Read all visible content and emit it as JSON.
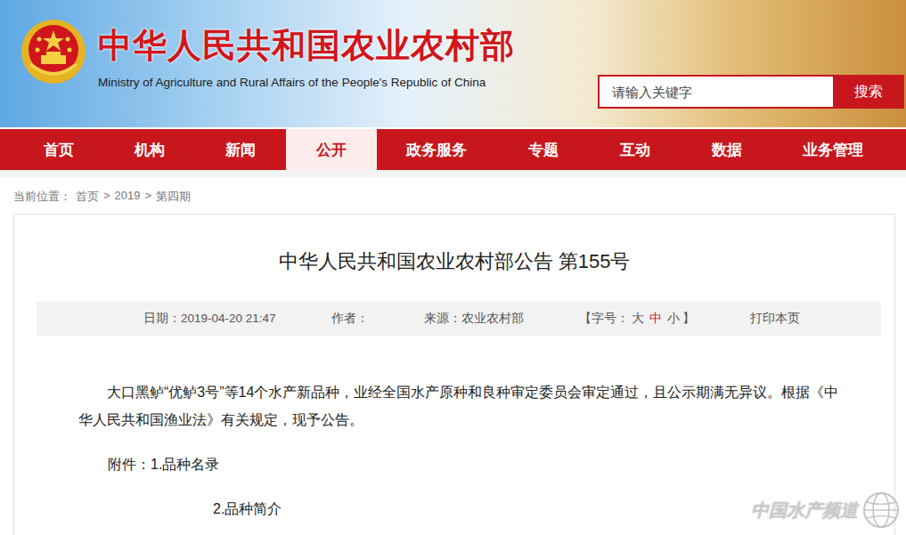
{
  "header": {
    "title": "中华人民共和国农业农村部",
    "subtitle": "Ministry of Agriculture and Rural Affairs of the People's Republic of China"
  },
  "search": {
    "placeholder": "请输入关键字",
    "button": "搜索"
  },
  "nav": [
    {
      "label": "首页",
      "selected": false
    },
    {
      "label": "机构",
      "selected": false
    },
    {
      "label": "新闻",
      "selected": false
    },
    {
      "label": "公开",
      "selected": true
    },
    {
      "label": "政务服务",
      "selected": false
    },
    {
      "label": "专题",
      "selected": false
    },
    {
      "label": "互动",
      "selected": false
    },
    {
      "label": "数据",
      "selected": false
    },
    {
      "label": "业务管理",
      "selected": false
    }
  ],
  "breadcrumb": {
    "label": "当前位置：",
    "separator": ">",
    "items": [
      "首页",
      "2019",
      "第四期"
    ]
  },
  "article": {
    "title": "中华人民共和国农业农村部公告 第155号",
    "meta": {
      "date_label": "日期：",
      "date": "2019-04-20 21:47",
      "author_label": "作者：",
      "source_label": "来源：",
      "source": "农业农村部",
      "font_open": "【字号：",
      "font_sizes": [
        {
          "label": "大",
          "selected": false
        },
        {
          "label": "中",
          "selected": true
        },
        {
          "label": "小",
          "selected": false
        }
      ],
      "font_close": "】",
      "print": "打印本页"
    },
    "body": "大口黑鲈“优鲈3号”等14个水产新品种，业经全国水产原种和良种审定委员会审定通过，且公示期满无异议。根据《中华人民共和国渔业法》有关规定，现予公告。",
    "attachments_label": "附件：",
    "attachments": [
      "1.品种名录",
      "2.品种简介"
    ]
  },
  "watermark": "中国水产频道"
}
